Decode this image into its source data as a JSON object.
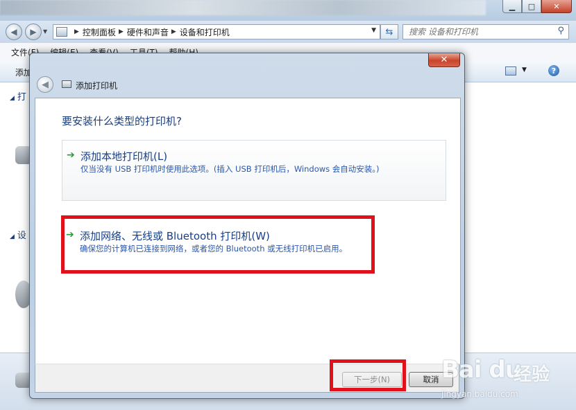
{
  "explorer": {
    "window_controls": {
      "minimize": "▁",
      "maximize": "□",
      "close": "✕"
    },
    "breadcrumb": [
      "控制面板",
      "硬件和声音",
      "设备和打印机"
    ],
    "search_placeholder": "搜索 设备和打印机",
    "menu": [
      "文件(F)",
      "编辑(E)",
      "查看(V)",
      "工具(T)",
      "帮助(H)"
    ],
    "command_partial": "添加",
    "section_printers_partial": "打",
    "section_devices_partial": "设"
  },
  "dialog": {
    "title": "添加打印机",
    "close_glyph": "✕",
    "question": "要安装什么类型的打印机?",
    "options": [
      {
        "title": "添加本地打印机(L)",
        "description": "仅当没有 USB 打印机时使用此选项。(插入 USB 打印机后，Windows 会自动安装。)"
      },
      {
        "title": "添加网络、无线或 Bluetooth 打印机(W)",
        "description": "确保您的计算机已连接到网络，或者您的 Bluetooth 或无线打印机已启用。"
      }
    ],
    "buttons": {
      "next": "下一步(N)",
      "cancel": "取消"
    }
  },
  "watermark": {
    "logo": "Bai du",
    "text": "经验",
    "url": "jingyan.baidu.com"
  },
  "colors": {
    "highlight_red": "#e0111b",
    "link_blue": "#153f8a",
    "arrow_green": "#2b9b3a"
  }
}
